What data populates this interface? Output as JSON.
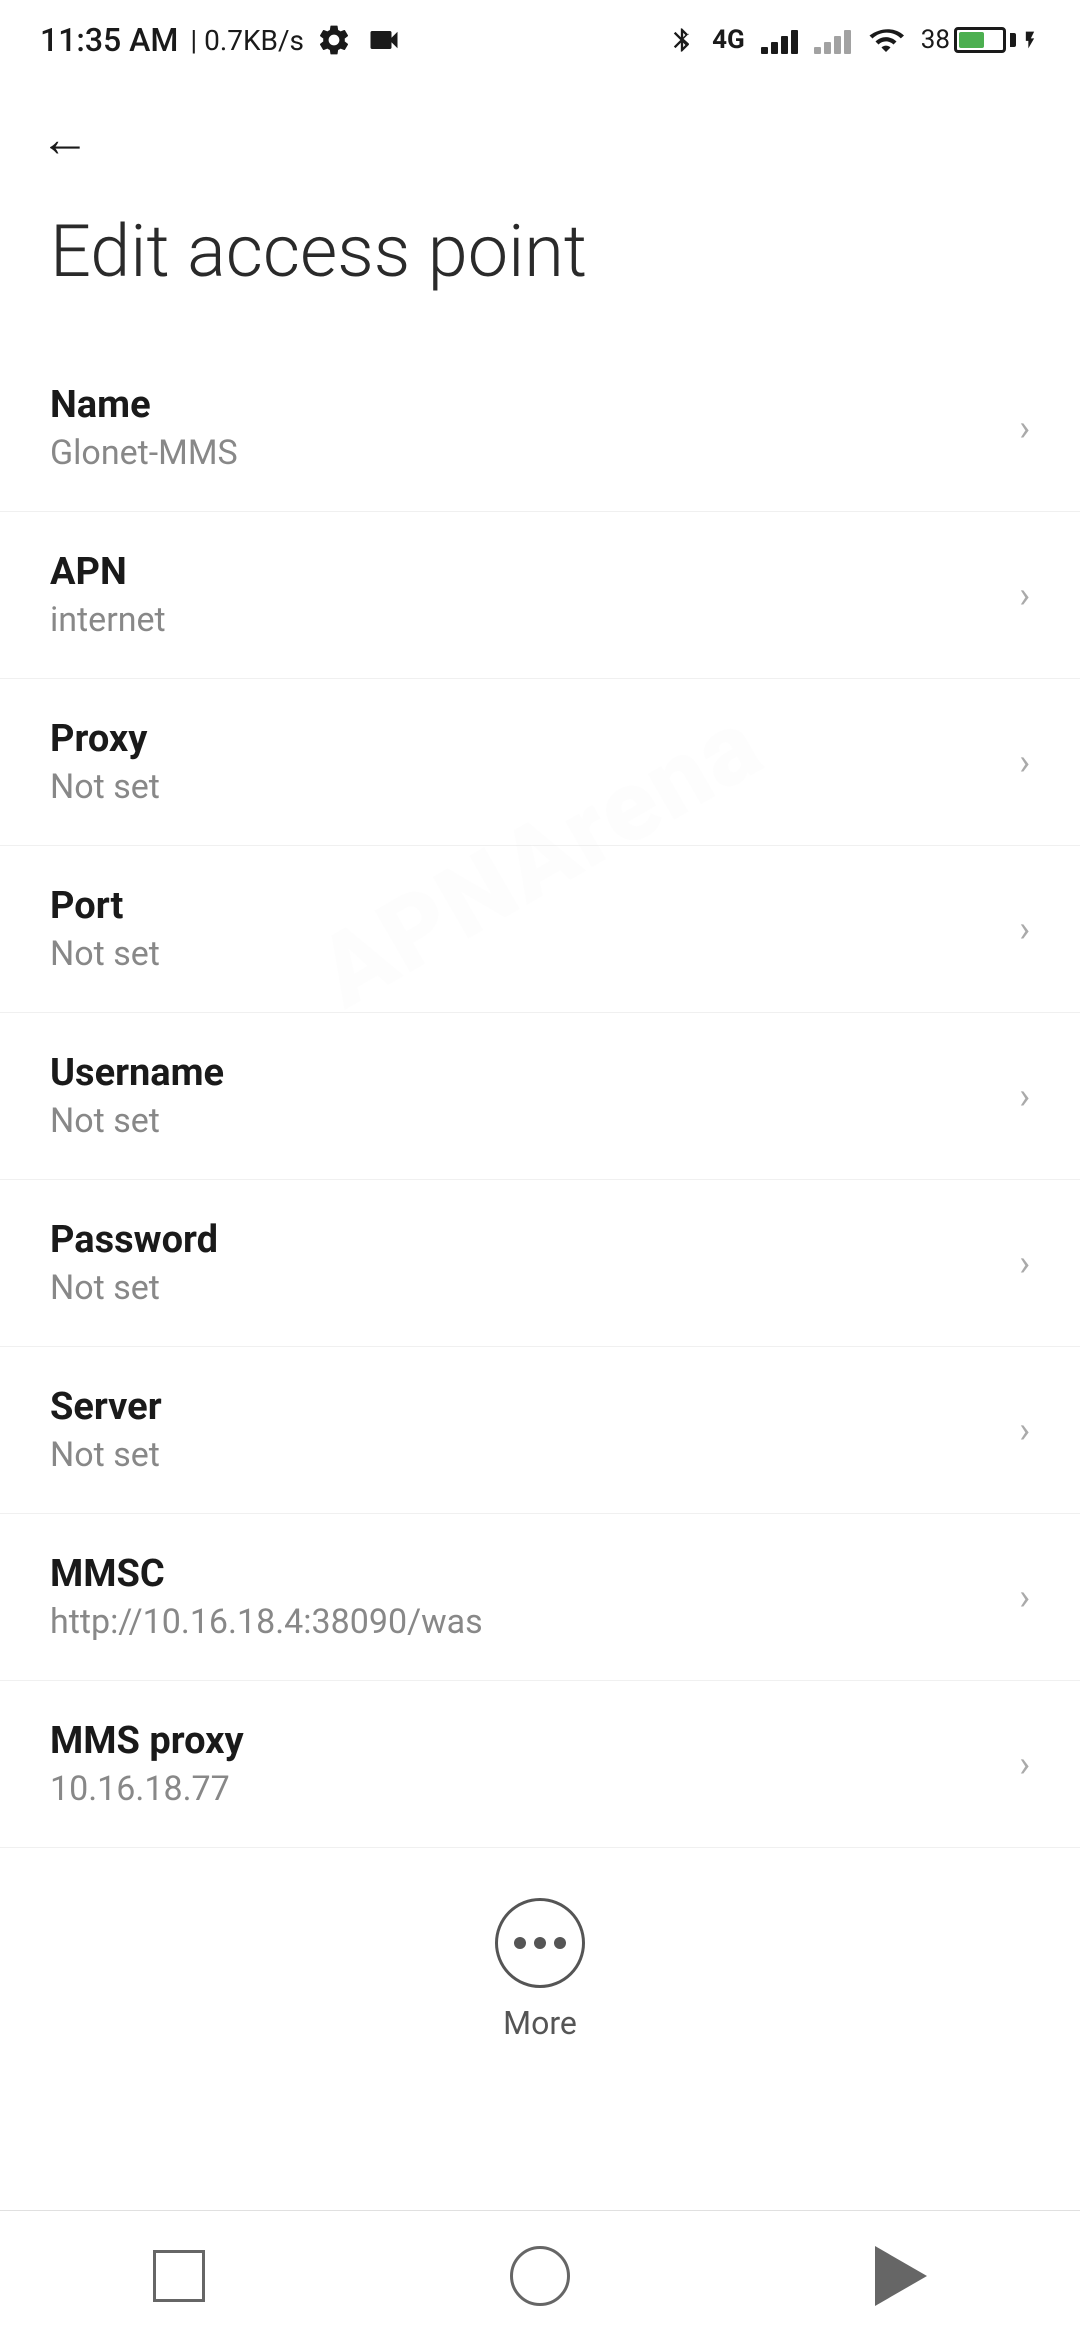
{
  "statusBar": {
    "time": "11:35 AM",
    "speed": "| 0.7KB/s",
    "network": "4G"
  },
  "page": {
    "title": "Edit access point",
    "backLabel": "←"
  },
  "settings": [
    {
      "label": "Name",
      "value": "Glonet-MMS"
    },
    {
      "label": "APN",
      "value": "internet"
    },
    {
      "label": "Proxy",
      "value": "Not set"
    },
    {
      "label": "Port",
      "value": "Not set"
    },
    {
      "label": "Username",
      "value": "Not set"
    },
    {
      "label": "Password",
      "value": "Not set"
    },
    {
      "label": "Server",
      "value": "Not set"
    },
    {
      "label": "MMSC",
      "value": "http://10.16.18.4:38090/was"
    },
    {
      "label": "MMS proxy",
      "value": "10.16.18.77"
    }
  ],
  "more": {
    "label": "More"
  },
  "watermark": "APNArena"
}
